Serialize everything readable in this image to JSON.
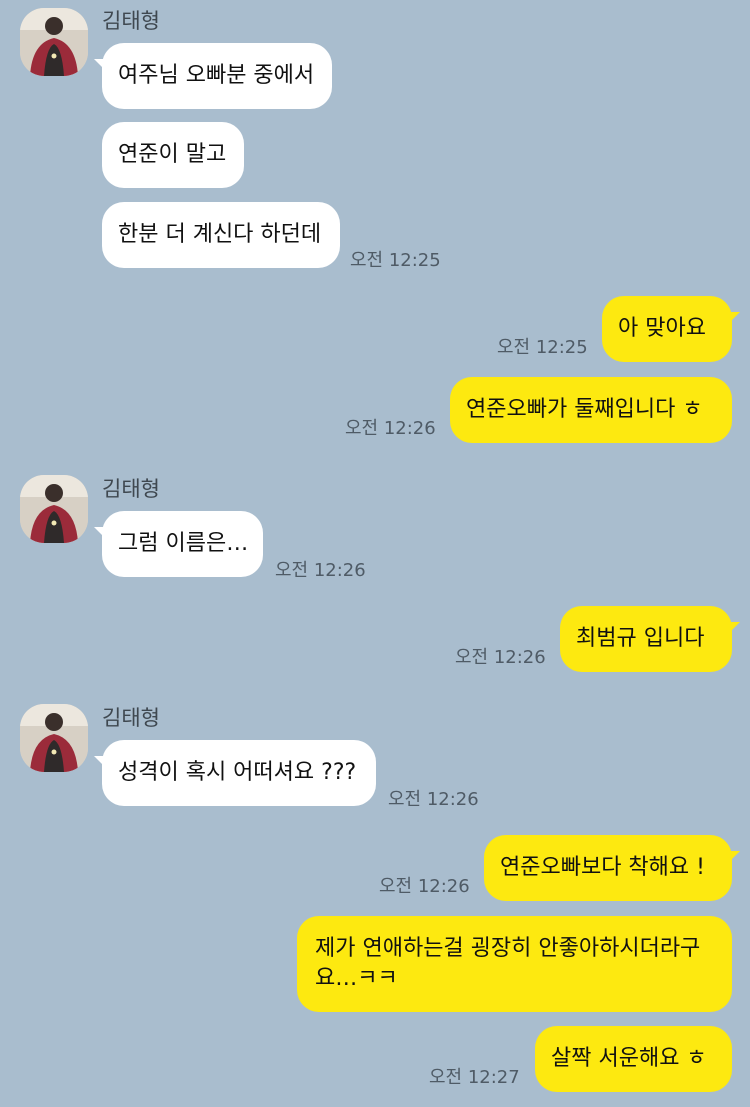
{
  "chat": {
    "sender_name": "김태형",
    "messages": [
      {
        "text": "여주님 오빠분 중에서"
      },
      {
        "text": "연준이 말고"
      },
      {
        "text": "한분 더 계신다 하던데",
        "time": "오전 12:25"
      },
      {
        "text": "아 맞아요",
        "time": "오전 12:25"
      },
      {
        "text": "연준오빠가 둘째입니다 ㅎ",
        "time": "오전 12:26"
      },
      {
        "text": "그럼 이름은…",
        "time": "오전 12:26"
      },
      {
        "text": "최범규 입니다",
        "time": "오전 12:26"
      },
      {
        "text": "성격이 혹시 어떠셔요 ???",
        "time": "오전 12:26"
      },
      {
        "text": "연준오빠보다 착해요 !",
        "time": "오전 12:26"
      },
      {
        "text": "제가 연애하는걸 굉장히 안좋아하시더라구요…ㅋㅋ"
      },
      {
        "text": "살짝 서운해요 ㅎ",
        "time": "오전 12:27"
      }
    ]
  },
  "colors": {
    "background": "#a9bdce",
    "incoming_bubble": "#ffffff",
    "outgoing_bubble": "#fde910"
  },
  "icons": {
    "avatar": "profile-photo"
  }
}
